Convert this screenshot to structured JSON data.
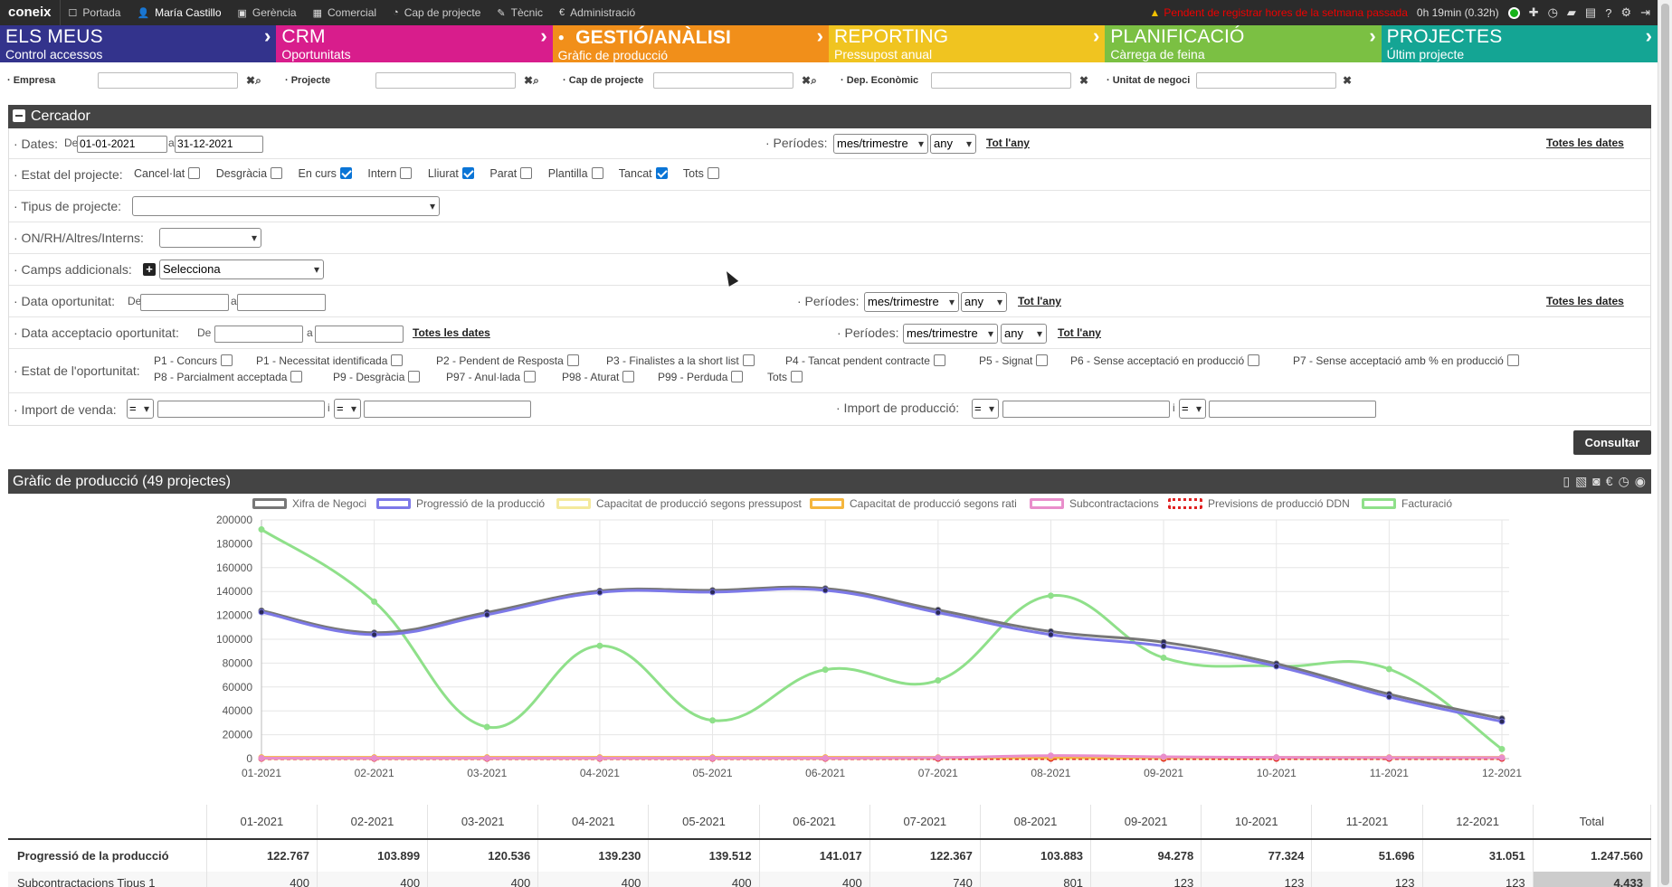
{
  "topbar": {
    "brand": "coneix",
    "nav": [
      {
        "label": "Portada",
        "icon": "□"
      },
      {
        "label": "María Castillo",
        "icon": "👤"
      },
      {
        "label": "Gerència",
        "icon": "▣"
      },
      {
        "label": "Comercial",
        "icon": "▦"
      },
      {
        "label": "Cap de projecte",
        "icon": "◔"
      },
      {
        "label": "Tècnic",
        "icon": "✎"
      },
      {
        "label": "Administració",
        "icon": "€"
      }
    ],
    "warning": "Pendent de registrar hores de la setmana passada",
    "timer": "0h 19min (0.32h)"
  },
  "modules": [
    {
      "title": "ELS MEUS",
      "sub": "Control accessos",
      "color": "#33338c"
    },
    {
      "title": "CRM",
      "sub": "Oportunitats",
      "color": "#d81d8c"
    },
    {
      "title": "GESTIÓ/ANÀLISI",
      "sub": "Gràfic de producció",
      "color": "#f18f1a"
    },
    {
      "title": "REPORTING",
      "sub": "Pressupost anual",
      "color": "#f0c420"
    },
    {
      "title": "PLANIFICACIÓ",
      "sub": "Càrrega de feina",
      "color": "#7bc043"
    },
    {
      "title": "PROJECTES",
      "sub": "Últim projecte",
      "color": "#14a594"
    }
  ],
  "filters": [
    {
      "label": "· Empresa"
    },
    {
      "label": "· Projecte"
    },
    {
      "label": "· Cap de projecte"
    },
    {
      "label": "· Dep. Econòmic"
    },
    {
      "label": "· Unitat de negoci"
    }
  ],
  "search": {
    "title": "Cercador",
    "dates_label": "· Dates:",
    "de": "De",
    "a": "a",
    "date_from": "01-01-2021",
    "date_to": "31-12-2021",
    "periodes_label": "· Períodes:",
    "periodes_value": "mes/trimestre",
    "any_value": "any",
    "tot_lany": "Tot l'any",
    "totes_dates": "Totes les dates",
    "estat_label": "· Estat del projecte:",
    "estats": [
      {
        "label": "Cancel·lat",
        "checked": false
      },
      {
        "label": "Desgràcia",
        "checked": false
      },
      {
        "label": "En curs",
        "checked": true
      },
      {
        "label": "Intern",
        "checked": false
      },
      {
        "label": "Lliurat",
        "checked": true
      },
      {
        "label": "Parat",
        "checked": false
      },
      {
        "label": "Plantilla",
        "checked": false
      },
      {
        "label": "Tancat",
        "checked": true
      },
      {
        "label": "Tots",
        "checked": false
      }
    ],
    "tipus_label": "· Tipus de projecte:",
    "on_label": "· ON/RH/Altres/Interns:",
    "camps_label": "· Camps addicionals:",
    "camps_value": "Selecciona",
    "data_op_label": "· Data oportunitat:",
    "data_acc_label": "· Data acceptacio oportunitat:",
    "estat_op_label": "· Estat de l'oportunitat:",
    "estat_op_row1": [
      "P1 - Concurs",
      "P1 - Necessitat identificada",
      "P2 - Pendent de Resposta",
      "P3 - Finalistes a la short list",
      "P4 - Tancat pendent contracte",
      "P5 - Signat",
      "P6 - Sense acceptació en producció",
      "P7 - Sense acceptació amb % en producció"
    ],
    "estat_op_row2": [
      "P8 - Parcialment acceptada",
      "P9 - Desgràcia",
      "P97 - Anul·lada",
      "P98 - Aturat",
      "P99 - Perduda",
      "Tots"
    ],
    "import_venda_label": "· Import de venda:",
    "import_prod_label": "· Import de producció:",
    "op_eq": "=",
    "i": "i",
    "consultar": "Consultar"
  },
  "chart_title": "Gràfic de producció (49 projectes)",
  "chart_data": {
    "type": "line",
    "categories": [
      "01-2021",
      "02-2021",
      "03-2021",
      "04-2021",
      "05-2021",
      "06-2021",
      "07-2021",
      "08-2021",
      "09-2021",
      "10-2021",
      "11-2021",
      "12-2021"
    ],
    "ylim": [
      0,
      200000
    ],
    "yticks": [
      0,
      20000,
      40000,
      60000,
      80000,
      100000,
      120000,
      140000,
      160000,
      180000,
      200000
    ],
    "grid": true,
    "legend_position": "top",
    "series": [
      {
        "name": "Xifra de Negoci",
        "color": "#777777",
        "values": [
          124000,
          105500,
          122500,
          140500,
          141000,
          142500,
          124500,
          106500,
          97500,
          79500,
          54000,
          33500
        ]
      },
      {
        "name": "Progressió de la producció",
        "color": "#7d79e8",
        "values": [
          122767,
          103899,
          120536,
          139230,
          139512,
          141017,
          122367,
          103883,
          94278,
          77324,
          51696,
          31051
        ]
      },
      {
        "name": "Capacitat de producció segons pressupost",
        "color": "#f4e99c",
        "values": [
          0,
          0,
          0,
          0,
          0,
          0,
          0,
          0,
          0,
          0,
          0,
          0
        ]
      },
      {
        "name": "Capacitat de producció segons rati",
        "color": "#f5b63e",
        "values": [
          1000,
          1000,
          1000,
          1000,
          1000,
          1000,
          1000,
          1000,
          1000,
          1000,
          1000,
          1000
        ]
      },
      {
        "name": "Subcontractacions",
        "color": "#e98ecb",
        "values": [
          400,
          400,
          400,
          400,
          400,
          400,
          740,
          2500,
          1500,
          1000,
          800,
          800
        ]
      },
      {
        "name": "Previsions de producció DDN",
        "color": "#e02020",
        "values": [
          0,
          0,
          0,
          0,
          0,
          0,
          0,
          0,
          0,
          0,
          0,
          0
        ]
      },
      {
        "name": "Facturació",
        "color": "#8fe08a",
        "values": [
          192000,
          131500,
          26500,
          94500,
          32000,
          74500,
          65500,
          136500,
          84500,
          77500,
          75000,
          8000
        ]
      }
    ]
  },
  "table": {
    "headers": [
      "",
      "01-2021",
      "02-2021",
      "03-2021",
      "04-2021",
      "05-2021",
      "06-2021",
      "07-2021",
      "08-2021",
      "09-2021",
      "10-2021",
      "11-2021",
      "12-2021",
      "Total"
    ],
    "rows": [
      [
        "Progressió de la producció",
        "122.767",
        "103.899",
        "120.536",
        "139.230",
        "139.512",
        "141.017",
        "122.367",
        "103.883",
        "94.278",
        "77.324",
        "51.696",
        "31.051",
        "1.247.560"
      ],
      [
        "Subcontractacions Tipus 1",
        "400",
        "400",
        "400",
        "400",
        "400",
        "400",
        "740",
        "801",
        "123",
        "123",
        "123",
        "123",
        "4.433"
      ]
    ]
  }
}
